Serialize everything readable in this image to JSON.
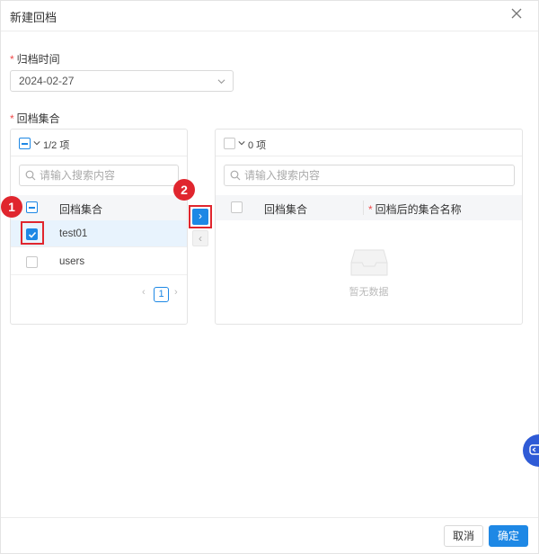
{
  "dialog": {
    "title": "新建回档"
  },
  "form": {
    "time_label": "归档时间",
    "date_value": "2024-02-27",
    "collection_label": "回档集合"
  },
  "left_panel": {
    "count_label": "1/2 项",
    "search_placeholder": "请输入搜索内容",
    "column_header": "回档集合",
    "rows": [
      {
        "name": "test01",
        "checked": true
      },
      {
        "name": "users",
        "checked": false
      }
    ],
    "page": "1"
  },
  "right_panel": {
    "count_label": "0 项",
    "search_placeholder": "请输入搜索内容",
    "col1_header": "回档集合",
    "col2_header": "回档后的集合名称",
    "empty_text": "暂无数据"
  },
  "annotations": {
    "step1": "1",
    "step2": "2"
  },
  "footer": {
    "cancel_label": "取消",
    "ok_label": "确定"
  },
  "colors": {
    "primary": "#1e88e5",
    "required": "#f04a4a",
    "annotation": "#e0262e"
  }
}
